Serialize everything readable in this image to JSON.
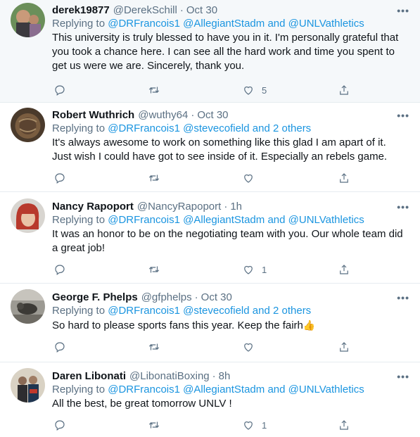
{
  "tweets": [
    {
      "name": "derek19877",
      "handle": "@DerekSchill",
      "sep": "·",
      "time": "Oct 30",
      "replying_label": "Replying to",
      "mention1": "@DRFrancois1",
      "mention2": "@AllegiantStadm",
      "and": "and",
      "mention3": "@UNLVathletics",
      "text": "This university is truly blessed to have you in it. I'm personally grateful that you took a chance here. I can see all the hard work and time you spent to get us were we are. Sincerely, thank you.",
      "likes": "5"
    },
    {
      "name": "Robert Wuthrich",
      "handle": "@wuthy64",
      "sep": "·",
      "time": "Oct 30",
      "replying_label": "Replying to",
      "mention1": "@DRFrancois1",
      "mention2": "@stevecofield",
      "and": "and",
      "mention3": "2 others",
      "text": "It's always awesome to work on something like this glad I am apart of it.  Just wish I could have got to see inside of it. Especially an rebels game.",
      "likes": ""
    },
    {
      "name": "Nancy Rapoport",
      "handle": "@NancyRapoport",
      "sep": "·",
      "time": "1h",
      "replying_label": "Replying to",
      "mention1": "@DRFrancois1",
      "mention2": "@AllegiantStadm",
      "and": "and",
      "mention3": "@UNLVathletics",
      "text": "It was an honor to be on the negotiating team with you.  Our whole team did a great job!",
      "likes": "1"
    },
    {
      "name": "George F. Phelps",
      "handle": "@gfphelps",
      "sep": "·",
      "time": "Oct 30",
      "replying_label": "Replying to",
      "mention1": "@DRFrancois1",
      "mention2": "@stevecofield",
      "and": "and",
      "mention3": "2 others",
      "text": "So hard to please sports fans this year. Keep the fairh",
      "emoji": "👍",
      "likes": ""
    },
    {
      "name": "Daren Libonati",
      "handle": "@LibonatiBoxing",
      "sep": "·",
      "time": "8h",
      "replying_label": "Replying to",
      "mention1": "@DRFrancois1",
      "mention2": "@AllegiantStadm",
      "and": "and",
      "mention3": "@UNLVathletics",
      "text": "All the best, be great tomorrow UNLV !",
      "likes": "1"
    }
  ],
  "more_glyph": "•••",
  "icons": [
    "reply-icon",
    "retweet-icon",
    "like-icon",
    "share-icon",
    "more-icon"
  ],
  "colors": {
    "link": "#1b95e0",
    "muted": "#5b7083",
    "text": "#0f1419",
    "highlight_bg": "#f5f8fa"
  }
}
